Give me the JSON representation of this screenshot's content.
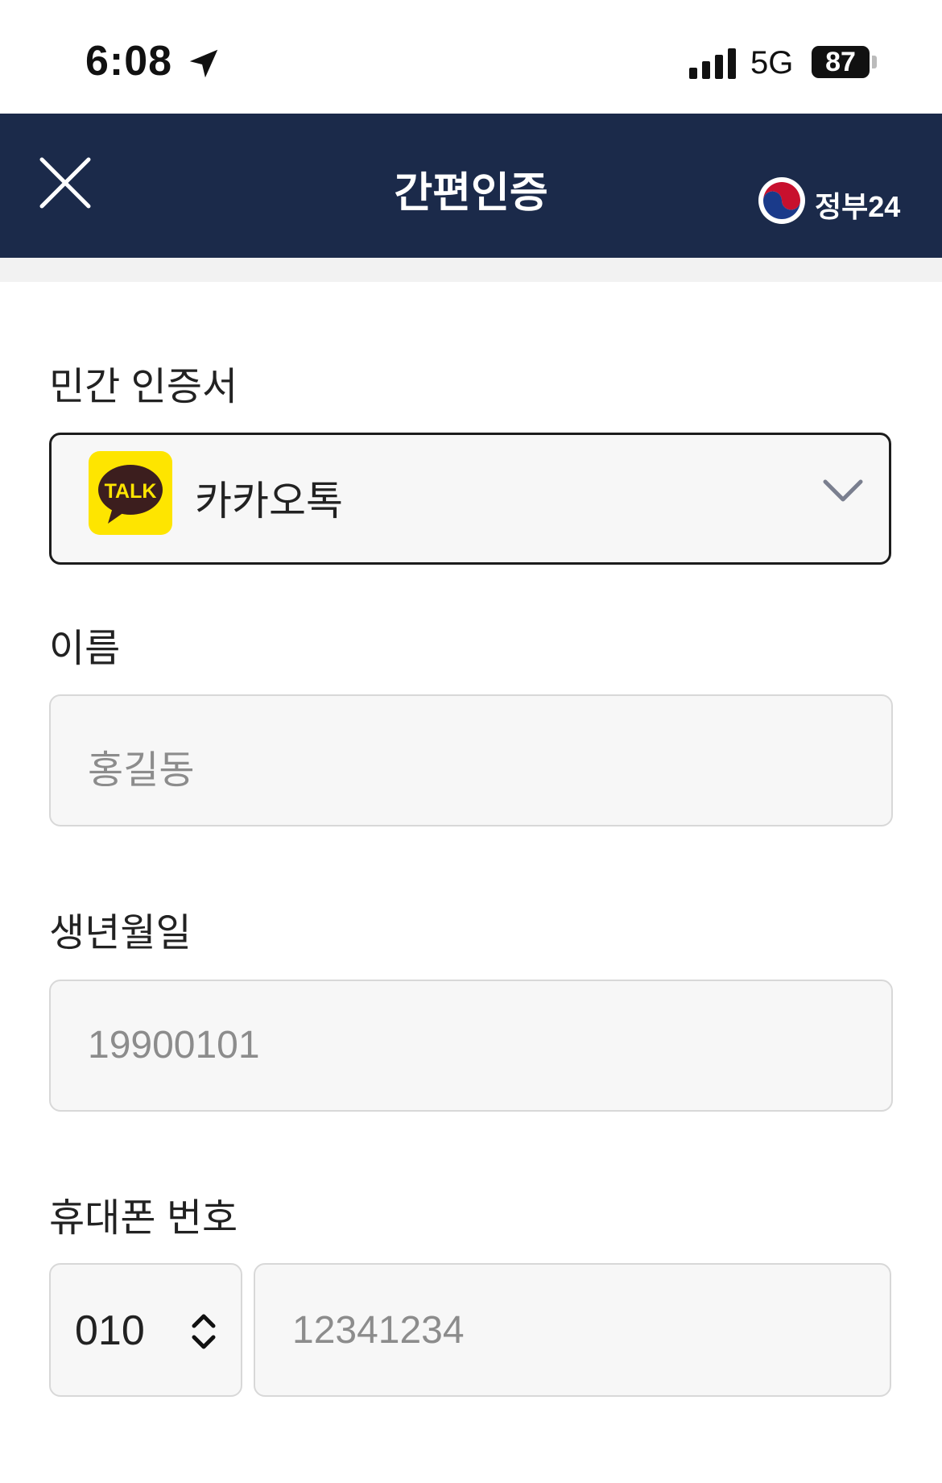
{
  "status_bar": {
    "time": "6:08",
    "network": "5G",
    "battery": "87",
    "icons": [
      "location-arrow-icon",
      "signal-icon",
      "battery-icon"
    ]
  },
  "header": {
    "title": "간편인증",
    "close_icon": "close-icon",
    "logo_text": "정부24",
    "background": "#1b2a4a"
  },
  "form": {
    "private_cert": {
      "label": "민간 인증서",
      "selected": "카카오톡",
      "provider_icon_text": "TALK",
      "provider_icon_color": "#fee500"
    },
    "name": {
      "label": "이름",
      "placeholder": "홍길동"
    },
    "birth": {
      "label": "생년월일",
      "placeholder": "19900101"
    },
    "phone": {
      "label": "휴대폰 번호",
      "prefix": "010",
      "placeholder": "12341234"
    }
  }
}
